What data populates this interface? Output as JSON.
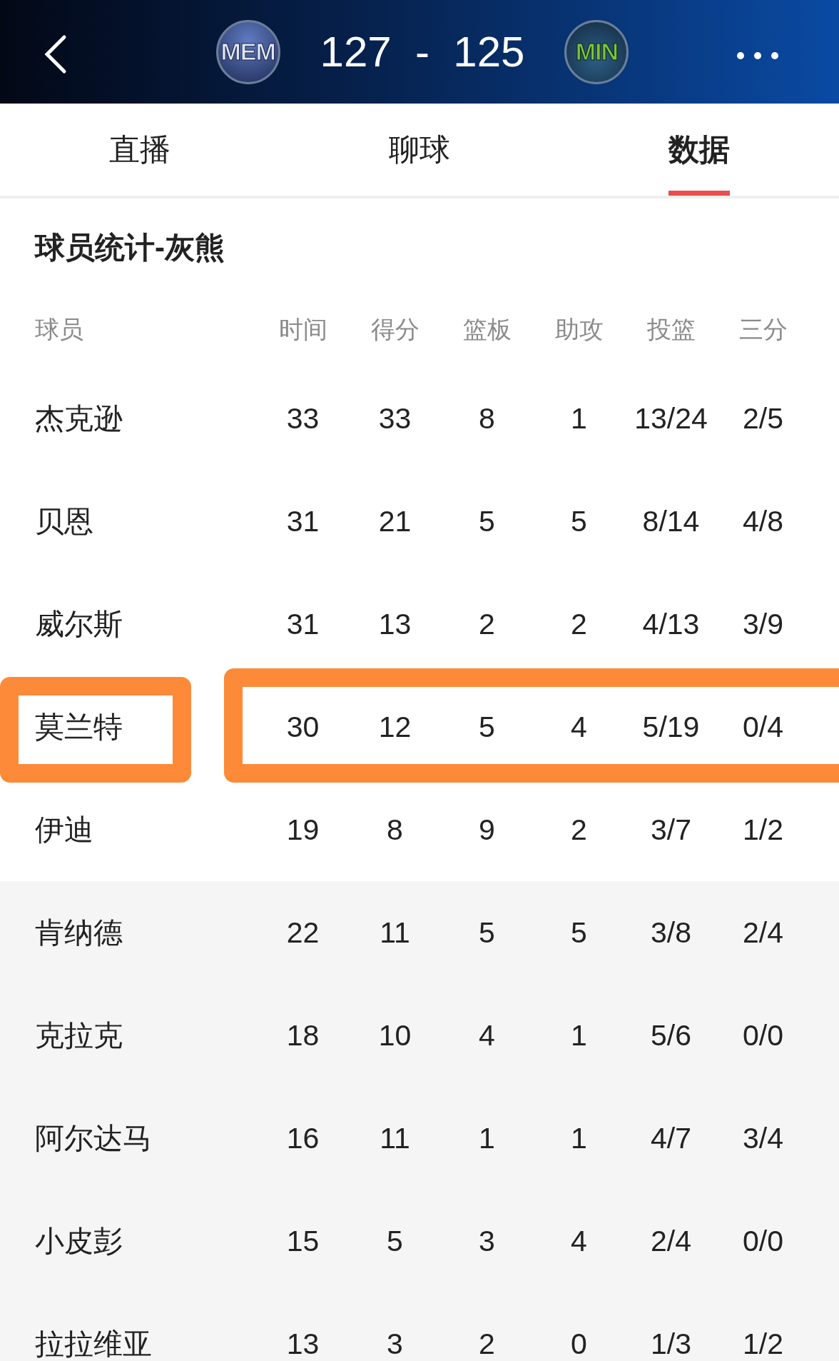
{
  "header": {
    "home_team": "MEM",
    "score": "127  -  125",
    "away_team": "MIN"
  },
  "tabs": [
    {
      "label": "直播",
      "selected": false
    },
    {
      "label": "聊球",
      "selected": false
    },
    {
      "label": "数据",
      "selected": true
    }
  ],
  "section_title": "球员统计-灰熊",
  "table": {
    "columns": [
      "球员",
      "时间",
      "得分",
      "篮板",
      "助攻",
      "投篮",
      "三分"
    ],
    "rows": [
      {
        "cells": [
          "杰克逊",
          "33",
          "33",
          "8",
          "1",
          "13/24",
          "2/5"
        ],
        "bench": false,
        "highlighted": false
      },
      {
        "cells": [
          "贝恩",
          "31",
          "21",
          "5",
          "5",
          "8/14",
          "4/8"
        ],
        "bench": false,
        "highlighted": false
      },
      {
        "cells": [
          "威尔斯",
          "31",
          "13",
          "2",
          "2",
          "4/13",
          "3/9"
        ],
        "bench": false,
        "highlighted": false
      },
      {
        "cells": [
          "莫兰特",
          "30",
          "12",
          "5",
          "4",
          "5/19",
          "0/4"
        ],
        "bench": false,
        "highlighted": true
      },
      {
        "cells": [
          "伊迪",
          "19",
          "8",
          "9",
          "2",
          "3/7",
          "1/2"
        ],
        "bench": false,
        "highlighted": false
      },
      {
        "cells": [
          "肯纳德",
          "22",
          "11",
          "5",
          "5",
          "3/8",
          "2/4"
        ],
        "bench": true,
        "highlighted": false
      },
      {
        "cells": [
          "克拉克",
          "18",
          "10",
          "4",
          "1",
          "5/6",
          "0/0"
        ],
        "bench": true,
        "highlighted": false
      },
      {
        "cells": [
          "阿尔达马",
          "16",
          "11",
          "1",
          "1",
          "4/7",
          "3/4"
        ],
        "bench": true,
        "highlighted": false
      },
      {
        "cells": [
          "小皮彭",
          "15",
          "5",
          "3",
          "4",
          "2/4",
          "0/0"
        ],
        "bench": true,
        "highlighted": false
      },
      {
        "cells": [
          "拉拉维亚",
          "13",
          "3",
          "2",
          "0",
          "1/3",
          "1/2"
        ],
        "bench": true,
        "highlighted": false
      }
    ]
  }
}
